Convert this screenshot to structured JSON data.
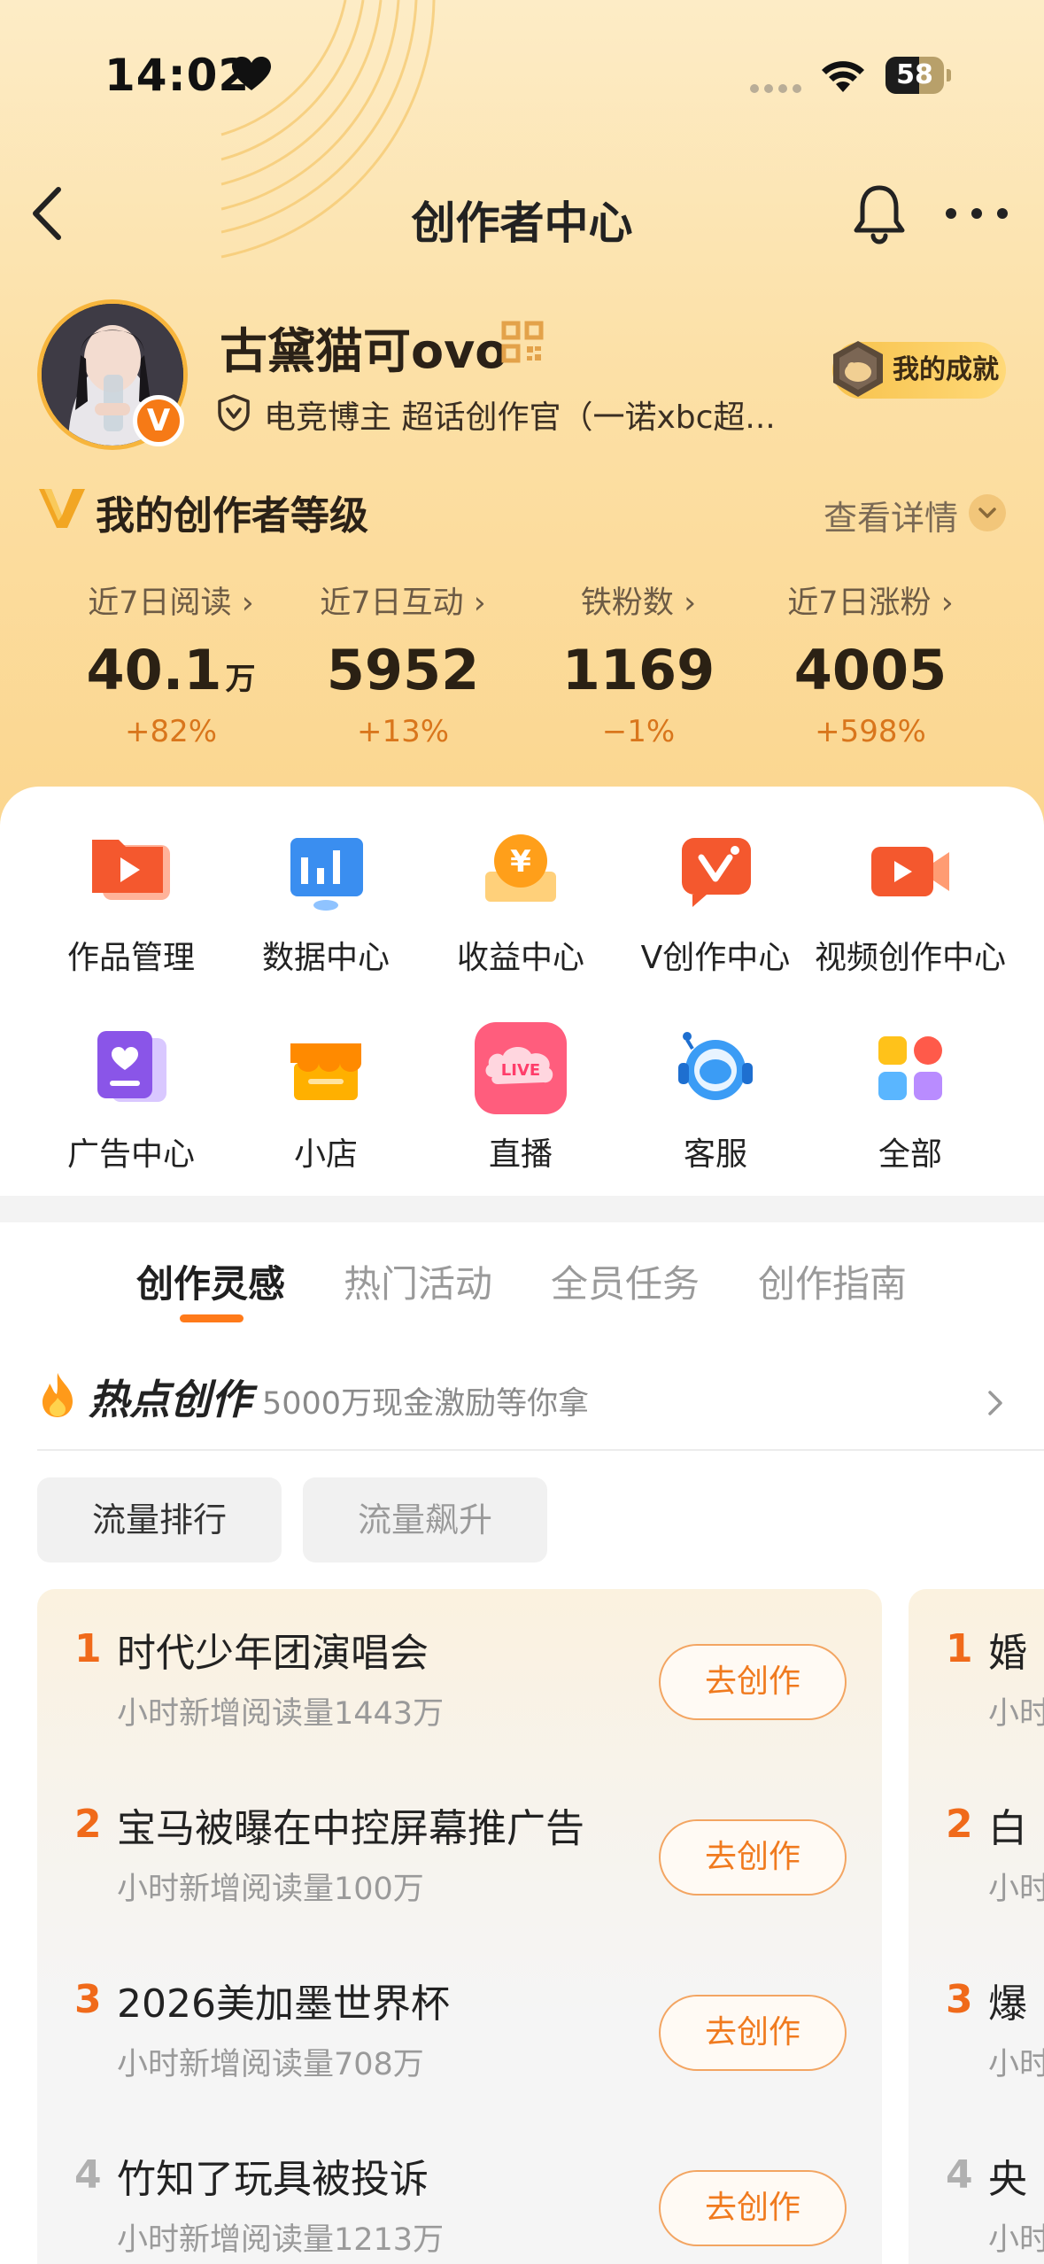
{
  "status_bar": {
    "time": "14:02",
    "battery": "58",
    "battery_level": 0.58
  },
  "nav": {
    "title": "创作者中心"
  },
  "profile": {
    "name": "古黛猫可ovo",
    "tags": "电竞博主 超话创作官（一诺xbc超...",
    "verified_badge": "V",
    "achievement_label": "我的成就"
  },
  "level": {
    "title": "我的创作者等级",
    "more": "查看详情"
  },
  "stats": [
    {
      "label": "近7日阅读",
      "value": "40.1",
      "unit": "万",
      "delta": "+82%"
    },
    {
      "label": "近7日互动",
      "value": "5952",
      "unit": "",
      "delta": "+13%"
    },
    {
      "label": "铁粉数",
      "value": "1169",
      "unit": "",
      "delta": "−1%"
    },
    {
      "label": "近7日涨粉",
      "value": "4005",
      "unit": "",
      "delta": "+598%"
    }
  ],
  "tools": [
    {
      "label": "作品管理",
      "icon": "folder-play-icon"
    },
    {
      "label": "数据中心",
      "icon": "bar-chart-icon"
    },
    {
      "label": "收益中心",
      "icon": "yen-coin-icon"
    },
    {
      "label": "V创作中心",
      "icon": "v-create-icon"
    },
    {
      "label": "视频创作中心",
      "icon": "video-camera-icon"
    },
    {
      "label": "广告中心",
      "icon": "heart-card-icon"
    },
    {
      "label": "小店",
      "icon": "shop-icon"
    },
    {
      "label": "直播",
      "icon": "live-icon",
      "badge": "LIVE"
    },
    {
      "label": "客服",
      "icon": "headset-icon"
    },
    {
      "label": "全部",
      "icon": "grid-icon"
    }
  ],
  "tabs": [
    "创作灵感",
    "热门活动",
    "全员任务",
    "创作指南"
  ],
  "hot": {
    "title": "热点创作",
    "subtitle": "5000万现金激励等你拿"
  },
  "chips": [
    "流量排行",
    "流量飙升"
  ],
  "ranking": [
    {
      "rank": "1",
      "title": "时代少年团演唱会",
      "sub": "小时新增阅读量1443万",
      "button": "去创作"
    },
    {
      "rank": "2",
      "title": "宝马被曝在中控屏幕推广告",
      "sub": "小时新增阅读量100万",
      "button": "去创作"
    },
    {
      "rank": "3",
      "title": "2026美加墨世界杯",
      "sub": "小时新增阅读量708万",
      "button": "去创作"
    },
    {
      "rank": "4",
      "title": "竹知了玩具被投诉",
      "sub": "小时新增阅读量1213万",
      "button": "去创作"
    }
  ],
  "ranking2": [
    {
      "rank": "1",
      "title": "婚",
      "sub": "小时"
    },
    {
      "rank": "2",
      "title": "白",
      "sub": "小时"
    },
    {
      "rank": "3",
      "title": "爆",
      "sub": "小时"
    },
    {
      "rank": "4",
      "title": "央",
      "sub": "小时"
    }
  ],
  "colors": {
    "accent": "#ff7a1a",
    "rank_top": "#f06a1a",
    "rank_other": "#b0b0b0",
    "hero": "#fce0a6"
  }
}
